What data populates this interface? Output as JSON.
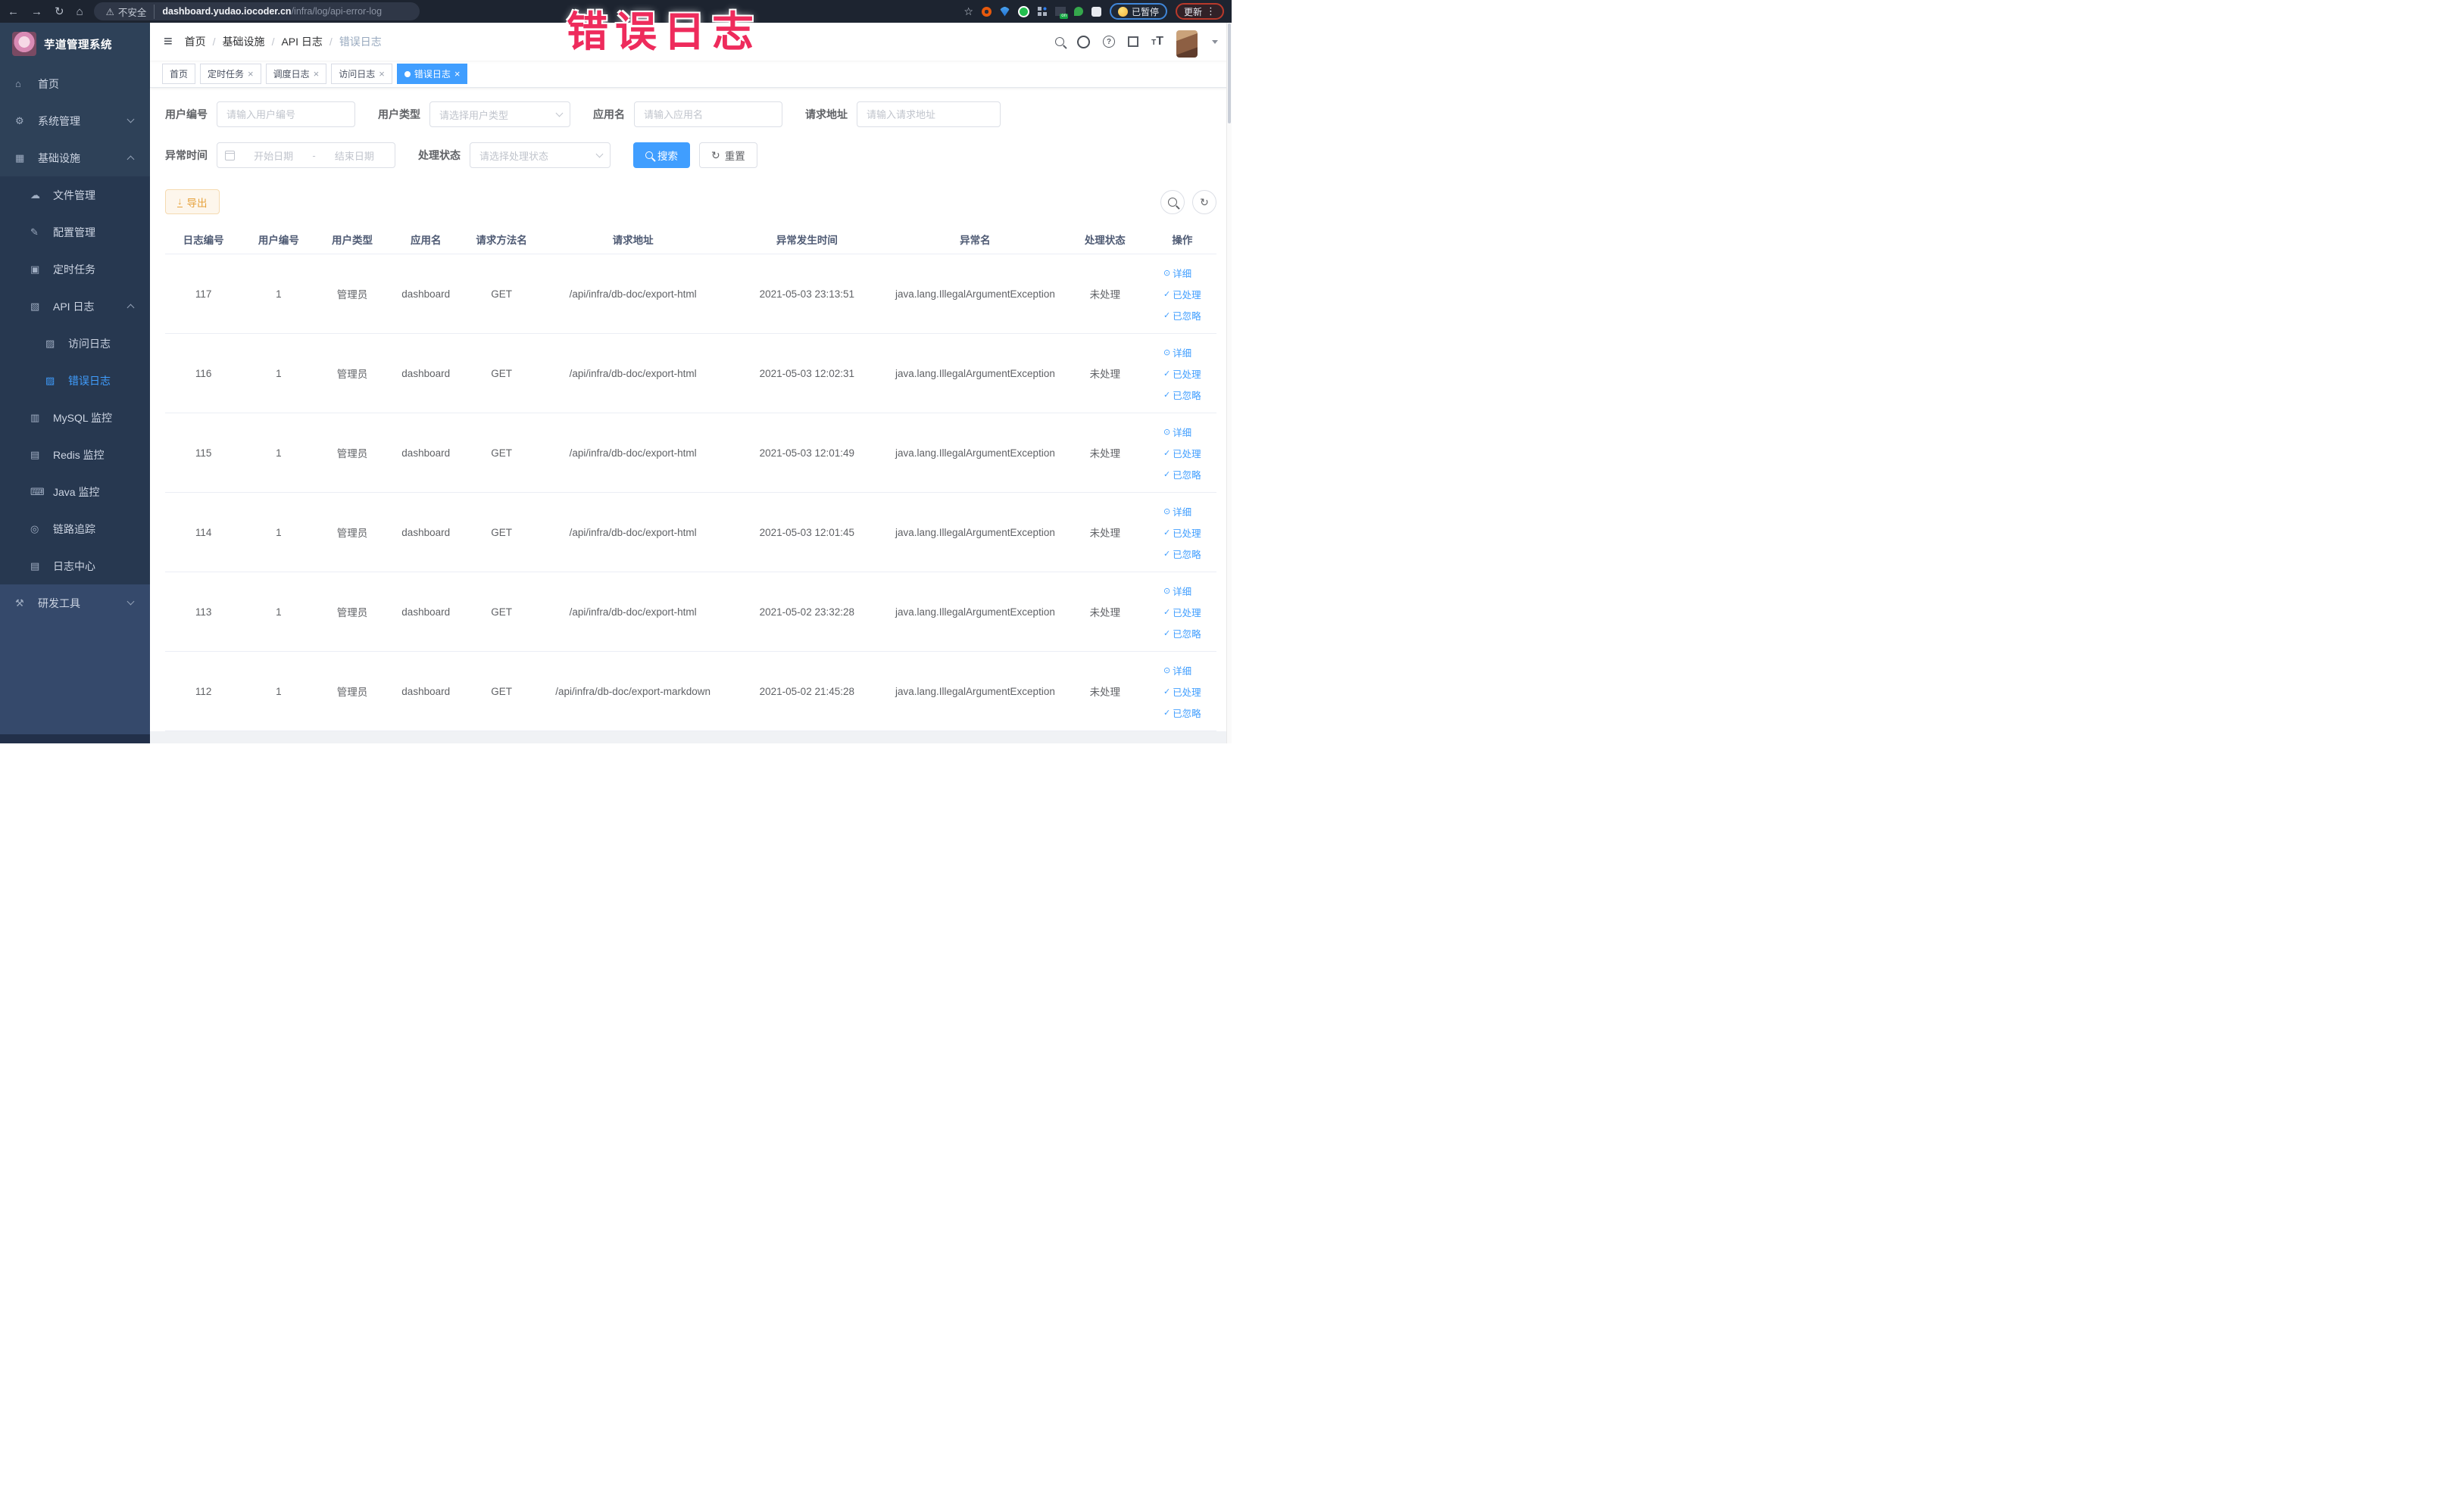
{
  "browser": {
    "security_label": "不安全",
    "url_host": "dashboard.yudao.iocoder.cn",
    "url_path": "/infra/log/api-error-log",
    "paused_label": "已暂停",
    "update_label": "更新",
    "ext_badge": "on"
  },
  "icons": {
    "back": "←",
    "forward": "→",
    "reload": "↻",
    "home": "⌂",
    "warning": "⚠",
    "star": "☆",
    "kebab": "⋮",
    "hamburger": "≡",
    "help": "?",
    "textsize_large": "T",
    "textsize_small": "T",
    "check": "✓",
    "close": "×",
    "eye": "⊙",
    "download": "↓",
    "refresh": "↻"
  },
  "annotation": {
    "text": "错误日志"
  },
  "sidebar": {
    "title": "芋道管理系统",
    "items": [
      {
        "label": "首页",
        "icon": "home-icon",
        "glyph": "⌂",
        "level": 0,
        "section": "base"
      },
      {
        "label": "系统管理",
        "icon": "gear-icon",
        "glyph": "⚙",
        "level": 0,
        "arrow": "down",
        "section": "base"
      },
      {
        "label": "基础设施",
        "icon": "infrastructure-icon",
        "glyph": "▦",
        "level": 0,
        "arrow": "up",
        "section": "base"
      },
      {
        "label": "文件管理",
        "icon": "file-manage-icon",
        "glyph": "☁",
        "level": 1,
        "section": "submenu"
      },
      {
        "label": "配置管理",
        "icon": "config-manage-icon",
        "glyph": "✎",
        "level": 1,
        "section": "submenu"
      },
      {
        "label": "定时任务",
        "icon": "scheduled-job-icon",
        "glyph": "▣",
        "level": 1,
        "section": "submenu"
      },
      {
        "label": "API 日志",
        "icon": "api-log-icon",
        "glyph": "▧",
        "level": 1,
        "arrow": "up",
        "section": "submenu"
      },
      {
        "label": "访问日志",
        "icon": "access-log-icon",
        "glyph": "▨",
        "level": 2,
        "section": "submenu"
      },
      {
        "label": "错误日志",
        "icon": "error-log-icon",
        "glyph": "▨",
        "level": 2,
        "active": true,
        "section": "submenu"
      },
      {
        "label": "MySQL 监控",
        "icon": "mysql-monitor-icon",
        "glyph": "▥",
        "level": 1,
        "section": "submenu"
      },
      {
        "label": "Redis 监控",
        "icon": "redis-monitor-icon",
        "glyph": "▤",
        "level": 1,
        "section": "submenu"
      },
      {
        "label": "Java 监控",
        "icon": "java-monitor-icon",
        "glyph": "⌨",
        "level": 1,
        "section": "submenu"
      },
      {
        "label": "链路追踪",
        "icon": "trace-icon",
        "glyph": "◎",
        "level": 1,
        "section": "submenu"
      },
      {
        "label": "日志中心",
        "icon": "log-center-icon",
        "glyph": "▤",
        "level": 1,
        "section": "submenu"
      },
      {
        "label": "研发工具",
        "icon": "dev-tool-icon",
        "glyph": "⚒",
        "level": 0,
        "arrow": "down",
        "section": "light"
      }
    ]
  },
  "navbar": {
    "breadcrumb": [
      "首页",
      "基础设施",
      "API 日志",
      "错误日志"
    ]
  },
  "tags": [
    {
      "label": "首页",
      "closable": false,
      "active": false
    },
    {
      "label": "定时任务",
      "closable": true,
      "active": false
    },
    {
      "label": "调度日志",
      "closable": true,
      "active": false
    },
    {
      "label": "访问日志",
      "closable": true,
      "active": false
    },
    {
      "label": "错误日志",
      "closable": true,
      "active": true
    }
  ],
  "filters": {
    "user_id": {
      "label": "用户编号",
      "placeholder": "请输入用户编号"
    },
    "user_type": {
      "label": "用户类型",
      "placeholder": "请选择用户类型"
    },
    "app_name": {
      "label": "应用名",
      "placeholder": "请输入应用名"
    },
    "request_url": {
      "label": "请求地址",
      "placeholder": "请输入请求地址"
    },
    "error_time": {
      "label": "异常时间",
      "start_placeholder": "开始日期",
      "separator": "-",
      "end_placeholder": "结束日期"
    },
    "process_status": {
      "label": "处理状态",
      "placeholder": "请选择处理状态"
    },
    "search_label": "搜索",
    "reset_label": "重置"
  },
  "toolbar": {
    "export_label": "导出"
  },
  "table": {
    "columns": [
      {
        "label": "日志编号",
        "key": "log_id",
        "width": 7.3
      },
      {
        "label": "用户编号",
        "key": "user_id",
        "width": 7
      },
      {
        "label": "用户类型",
        "key": "user_type",
        "width": 7
      },
      {
        "label": "应用名",
        "key": "app_name",
        "width": 7
      },
      {
        "label": "请求方法名",
        "key": "method",
        "width": 7.4
      },
      {
        "label": "请求地址",
        "key": "request_url",
        "width": 17.6
      },
      {
        "label": "异常发生时间",
        "key": "error_time",
        "width": 15.5
      },
      {
        "label": "异常名",
        "key": "exception_name",
        "width": 16.5
      },
      {
        "label": "处理状态",
        "key": "process_status",
        "width": 8.2
      },
      {
        "label": "操作",
        "key": "_actions",
        "width": 6.5
      }
    ],
    "rows": [
      {
        "log_id": "117",
        "user_id": "1",
        "user_type": "管理员",
        "app_name": "dashboard",
        "method": "GET",
        "request_url": "/api/infra/db-doc/export-html",
        "error_time": "2021-05-03 23:13:51",
        "exception_name": "java.lang.IllegalArgumentException",
        "process_status": "未处理"
      },
      {
        "log_id": "116",
        "user_id": "1",
        "user_type": "管理员",
        "app_name": "dashboard",
        "method": "GET",
        "request_url": "/api/infra/db-doc/export-html",
        "error_time": "2021-05-03 12:02:31",
        "exception_name": "java.lang.IllegalArgumentException",
        "process_status": "未处理"
      },
      {
        "log_id": "115",
        "user_id": "1",
        "user_type": "管理员",
        "app_name": "dashboard",
        "method": "GET",
        "request_url": "/api/infra/db-doc/export-html",
        "error_time": "2021-05-03 12:01:49",
        "exception_name": "java.lang.IllegalArgumentException",
        "process_status": "未处理"
      },
      {
        "log_id": "114",
        "user_id": "1",
        "user_type": "管理员",
        "app_name": "dashboard",
        "method": "GET",
        "request_url": "/api/infra/db-doc/export-html",
        "error_time": "2021-05-03 12:01:45",
        "exception_name": "java.lang.IllegalArgumentException",
        "process_status": "未处理"
      },
      {
        "log_id": "113",
        "user_id": "1",
        "user_type": "管理员",
        "app_name": "dashboard",
        "method": "GET",
        "request_url": "/api/infra/db-doc/export-html",
        "error_time": "2021-05-02 23:32:28",
        "exception_name": "java.lang.IllegalArgumentException",
        "process_status": "未处理"
      },
      {
        "log_id": "112",
        "user_id": "1",
        "user_type": "管理员",
        "app_name": "dashboard",
        "method": "GET",
        "request_url": "/api/infra/db-doc/export-markdown",
        "error_time": "2021-05-02 21:45:28",
        "exception_name": "java.lang.IllegalArgumentException",
        "process_status": "未处理"
      }
    ],
    "actions": [
      {
        "label": "详细",
        "icon": "eye-icon",
        "glyph": "⊙"
      },
      {
        "label": "已处理",
        "icon": "check-icon",
        "glyph": "✓"
      },
      {
        "label": "已忽略",
        "icon": "check-icon",
        "glyph": "✓"
      }
    ]
  },
  "colors": {
    "accent": "#409eff",
    "warning": "#e6a23c",
    "annotation": "#ee2b5c",
    "sidebar_bg": "#2e4158"
  }
}
